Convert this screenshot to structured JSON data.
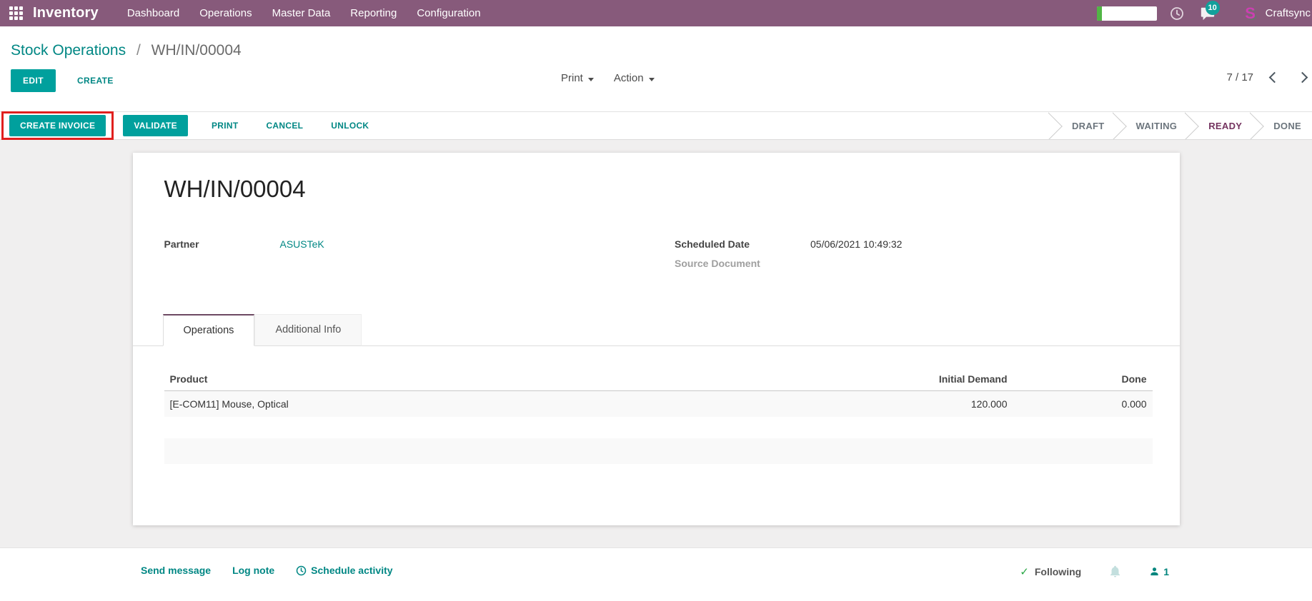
{
  "topbar": {
    "app_name": "Inventory",
    "menus": [
      "Dashboard",
      "Operations",
      "Master Data",
      "Reporting",
      "Configuration"
    ],
    "systray": {
      "messages_badge": "10",
      "user_initial": "S",
      "user_name": "Craftsync"
    }
  },
  "control_panel": {
    "breadcrumb": {
      "parent": "Stock Operations",
      "separator": "/",
      "current": "WH/IN/00004"
    },
    "edit_button": "EDIT",
    "create_button": "CREATE",
    "print_menu": "Print",
    "action_menu": "Action",
    "pager": "7 / 17"
  },
  "statusbar": {
    "buttons": [
      {
        "label": "CREATE INVOICE",
        "style": "primary",
        "highlighted": true
      },
      {
        "label": "VALIDATE",
        "style": "primary",
        "highlighted": false
      },
      {
        "label": "PRINT",
        "style": "link",
        "highlighted": false
      },
      {
        "label": "CANCEL",
        "style": "link",
        "highlighted": false
      },
      {
        "label": "UNLOCK",
        "style": "link",
        "highlighted": false
      }
    ],
    "states": [
      {
        "label": "DRAFT",
        "active": false
      },
      {
        "label": "WAITING",
        "active": false
      },
      {
        "label": "READY",
        "active": true
      },
      {
        "label": "DONE",
        "active": false
      }
    ]
  },
  "form": {
    "title": "WH/IN/00004",
    "fields": {
      "partner": {
        "label": "Partner",
        "value": "ASUSTeK"
      },
      "scheduled_date": {
        "label": "Scheduled Date",
        "value": "05/06/2021 10:49:32"
      },
      "source_document": {
        "label": "Source Document",
        "value": ""
      }
    },
    "tabs": [
      {
        "label": "Operations",
        "active": true
      },
      {
        "label": "Additional Info",
        "active": false
      }
    ],
    "table": {
      "columns": [
        "Product",
        "Initial Demand",
        "Done"
      ],
      "rows": [
        {
          "product": "[E-COM11] Mouse, Optical",
          "initial_demand": "120.000",
          "done": "0.000"
        }
      ]
    }
  },
  "chatter": {
    "send_message": "Send message",
    "log_note": "Log note",
    "schedule_activity": "Schedule activity",
    "following_label": "Following",
    "followers_count": "1"
  },
  "icons": {
    "apps": "grid-3x3",
    "topbar_clock": "clock",
    "messages": "chat-bubble",
    "pager_prev": "chevron-left",
    "pager_next": "chevron-right",
    "dropdown": "caret-down",
    "schedule": "clock",
    "following_check": "check",
    "notification": "bell",
    "followers": "person"
  },
  "colors": {
    "topbar_bg": "#875a7b",
    "primary_button": "#00a09d",
    "link_teal": "#008784",
    "active_state": "#74335f",
    "highlight_red": "#e0201e",
    "check_green": "#28a745",
    "timer_green": "#51b545",
    "content_bg": "#f0efef"
  }
}
